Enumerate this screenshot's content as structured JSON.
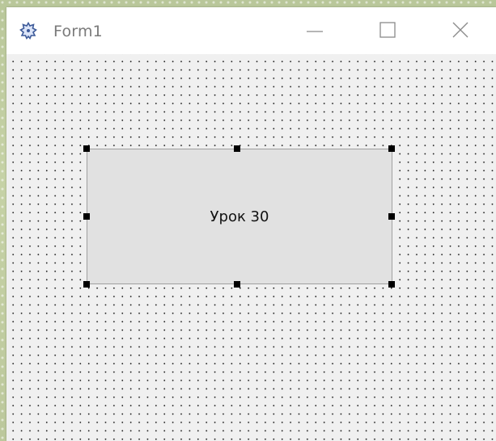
{
  "window": {
    "title": "Form1",
    "icon": "form-designer-icon",
    "controls": {
      "minimize": "minimize-icon",
      "maximize": "maximize-icon",
      "close": "close-icon"
    }
  },
  "form": {
    "button": {
      "label": "Урок 30"
    }
  },
  "colors": {
    "client_background": "#f0f0f0",
    "grid_dot": "#202020",
    "button_face": "#e1e1e1",
    "button_border": "#a0a0a0",
    "selection_handle": "#000000",
    "title_text": "#7a7a7a"
  }
}
